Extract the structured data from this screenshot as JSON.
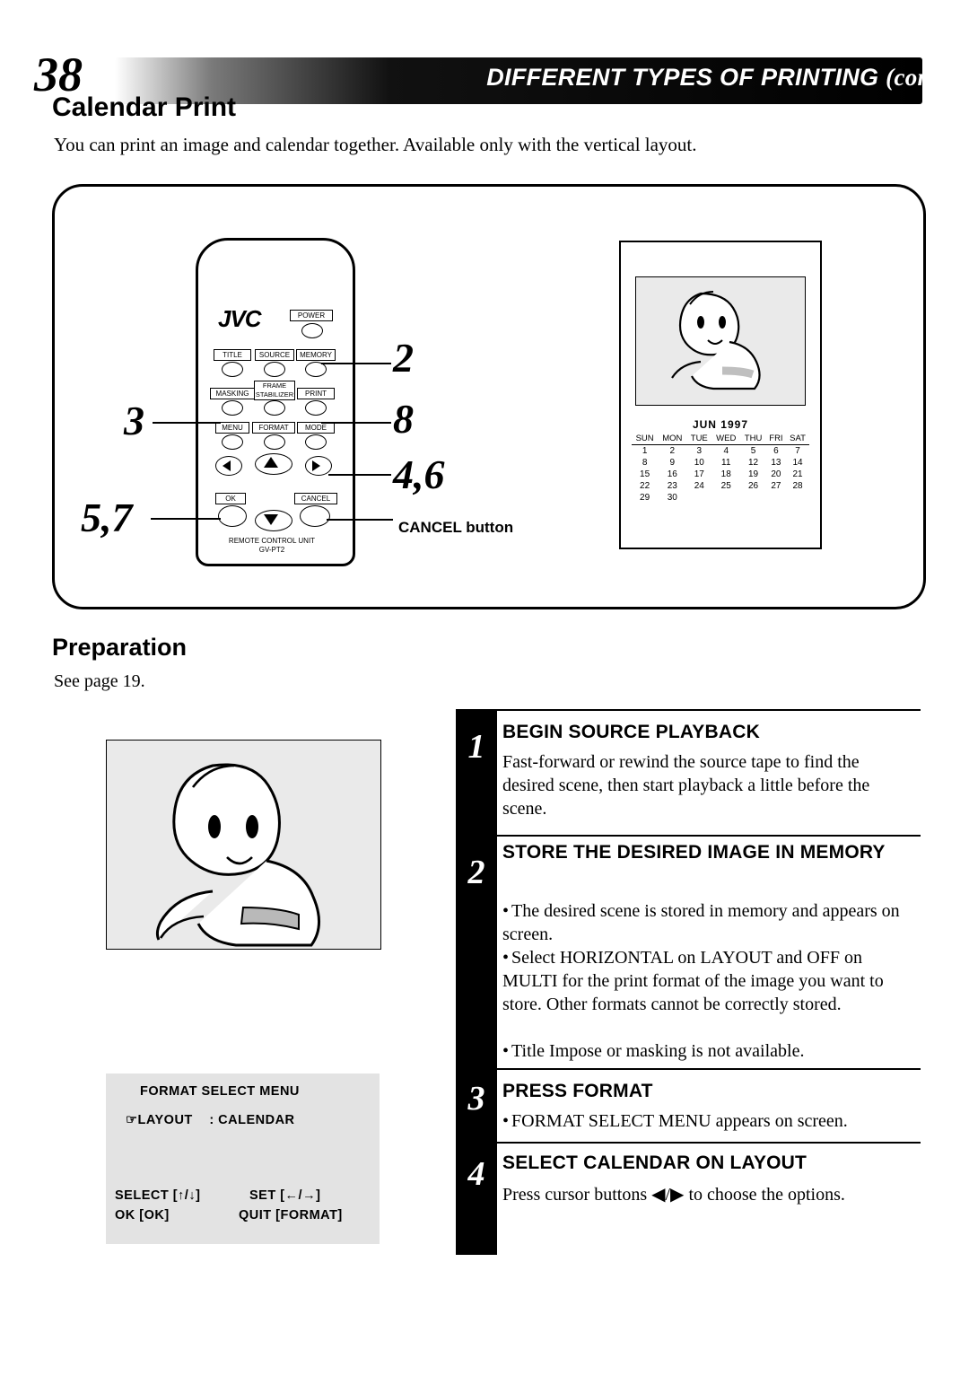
{
  "header": {
    "page_number": "38",
    "title": "DIFFERENT TYPES OF PRINTING",
    "title_cont": "(cont.)"
  },
  "section": {
    "title": "Calendar Print",
    "intro": "You can print an image and calendar together. Available only with the vertical layout."
  },
  "remote": {
    "brand": "JVC",
    "power_label": "POWER",
    "buttons_row1": [
      "TITLE",
      "SOURCE",
      "MEMORY"
    ],
    "buttons_row2": [
      "MASKING",
      "FRAME STABILIZER",
      "PRINT"
    ],
    "frame_label_line1": "FRAME",
    "frame_label_line2": "STABILIZER",
    "buttons_row3": [
      "MENU",
      "FORMAT",
      "MODE"
    ],
    "ok_label": "OK",
    "cancel_label": "CANCEL",
    "footer_line1": "REMOTE CONTROL UNIT",
    "footer_line2": "GV-PT2",
    "callouts": {
      "left_top": "3",
      "left_bottom": "5,7",
      "right_top": "2",
      "right_mid": "8",
      "right_bottom": "4,6"
    },
    "cancel_callout": "CANCEL button"
  },
  "print_sample": {
    "calendar_title": "JUN  1997",
    "weekday_headers": [
      "SUN",
      "MON",
      "TUE",
      "WED",
      "THU",
      "FRI",
      "SAT"
    ],
    "weeks": [
      [
        "1",
        "2",
        "3",
        "4",
        "5",
        "6",
        "7"
      ],
      [
        "8",
        "9",
        "10",
        "11",
        "12",
        "13",
        "14"
      ],
      [
        "15",
        "16",
        "17",
        "18",
        "19",
        "20",
        "21"
      ],
      [
        "22",
        "23",
        "24",
        "25",
        "26",
        "27",
        "28"
      ],
      [
        "29",
        "30",
        "",
        "",
        "",
        "",
        ""
      ]
    ]
  },
  "preparation": {
    "heading": "Preparation",
    "text": "See page  19."
  },
  "osd_menu": {
    "title": "FORMAT  SELECT  MENU",
    "row_label": "LAYOUT",
    "row_value": ":  CALENDAR",
    "select_hint": "SELECT [↑/↓]",
    "set_hint": "SET [←/→]",
    "ok_hint": "OK [OK]",
    "quit_hint": "QUIT [FORMAT]"
  },
  "steps": [
    {
      "number": "1",
      "heading": "BEGIN SOURCE PLAYBACK",
      "body": "Fast-forward or rewind the source tape to find the desired scene, then start playback a little before the scene."
    },
    {
      "number": "2",
      "heading": "STORE THE DESIRED IMAGE IN MEMORY",
      "bullets": [
        "The desired scene is stored in memory and appears on screen.",
        "Select HORIZONTAL on LAYOUT and OFF on MULTI for the print format of the image you want to store.  Other formats cannot be correctly stored.",
        "Title Impose or masking is not available."
      ]
    },
    {
      "number": "3",
      "heading": "PRESS FORMAT",
      "bullets": [
        "FORMAT SELECT MENU appears on screen."
      ]
    },
    {
      "number": "4",
      "heading": "SELECT CALENDAR ON LAYOUT",
      "body_pre": "Press cursor buttons ",
      "body_arrows": "◀/▶",
      "body_post": " to choose the options."
    }
  ]
}
